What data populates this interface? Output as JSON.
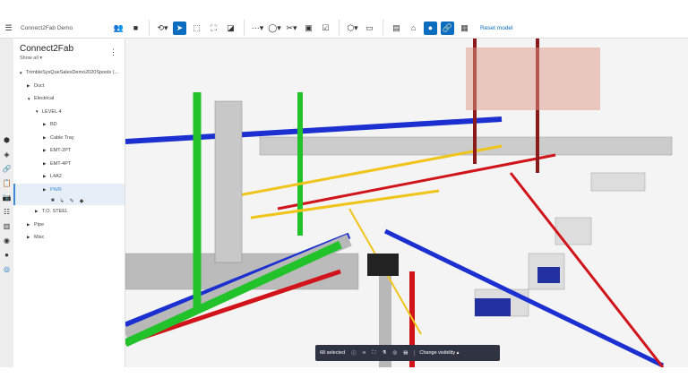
{
  "app": {
    "title": "Connect2Fab Demo",
    "reset_label": "Reset model"
  },
  "panel": {
    "title": "Connect2Fab",
    "show_all": "Show all"
  },
  "tree": [
    {
      "label": "TrimbleSysQueSalesDemo2020Spools (...",
      "level": 0,
      "expanded": true
    },
    {
      "label": "Duct",
      "level": 1,
      "expanded": false
    },
    {
      "label": "Electrical",
      "level": 1,
      "expanded": true
    },
    {
      "label": "LEVEL 4",
      "level": 2,
      "expanded": true
    },
    {
      "label": "BD",
      "level": 3,
      "expanded": false
    },
    {
      "label": "Cable Tray",
      "level": 3,
      "expanded": false
    },
    {
      "label": "EMT-2PT",
      "level": 3,
      "expanded": false
    },
    {
      "label": "EMT-4PT",
      "level": 3,
      "expanded": false
    },
    {
      "label": "L4A2",
      "level": 3,
      "expanded": false
    },
    {
      "label": "PWR",
      "level": 3,
      "expanded": false,
      "selected": true
    },
    {
      "label": "T.O. STEEL",
      "level": 2,
      "expanded": false
    },
    {
      "label": "Pipe",
      "level": 1,
      "expanded": false
    },
    {
      "label": "Misc",
      "level": 1,
      "expanded": false
    }
  ],
  "selection": {
    "count_label": "68 selected",
    "visibility_label": "Change visibility"
  },
  "colors": {
    "accent": "#0a6dbf",
    "selbar": "#2f3342",
    "pipe_green": "#22c32a",
    "pipe_red": "#d0141a",
    "pipe_blue": "#1c2fd0",
    "tray_yellow": "#f0c419"
  }
}
